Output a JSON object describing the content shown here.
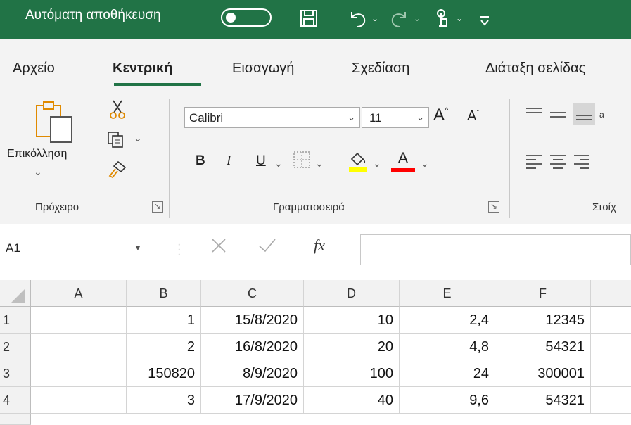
{
  "titlebar": {
    "autosave_label": "Αυτόματη αποθήκευση",
    "toggle_state": "off",
    "accent_color": "#217346",
    "qat_icons": [
      "save-icon",
      "undo-icon",
      "redo-icon",
      "touch-mode-icon",
      "customize-qat-icon"
    ]
  },
  "tabs": [
    {
      "label": "Αρχείο"
    },
    {
      "label": "Κεντρική",
      "active": true
    },
    {
      "label": "Εισαγωγή"
    },
    {
      "label": "Σχεδίαση"
    },
    {
      "label": "Διάταξη σελίδας"
    }
  ],
  "clipboard": {
    "paste_label": "Επικόλληση",
    "group_label": "Πρόχειρο"
  },
  "font": {
    "name": "Calibri",
    "size": "11",
    "group_label": "Γραμματοσειρά",
    "bold": "B",
    "italic": "I",
    "underline": "U",
    "font_color_letter": "A",
    "grow": "A",
    "shrink": "A",
    "highlight_color": "#ffff00",
    "font_color": "#ff0000"
  },
  "alignment": {
    "group_label": "Στοίχ"
  },
  "formula_bar": {
    "namebox": "A1",
    "fx": "fx",
    "formula": ""
  },
  "sheet": {
    "columns": [
      "A",
      "B",
      "C",
      "D",
      "E",
      "F"
    ],
    "rows": [
      {
        "num": "1",
        "cells": [
          "",
          "1",
          "15/8/2020",
          "10",
          "2,4",
          "12345"
        ]
      },
      {
        "num": "2",
        "cells": [
          "",
          "2",
          "16/8/2020",
          "20",
          "4,8",
          "54321"
        ]
      },
      {
        "num": "3",
        "cells": [
          "",
          "150820",
          "8/9/2020",
          "100",
          "24",
          "300001"
        ]
      },
      {
        "num": "4",
        "cells": [
          "",
          "3",
          "17/9/2020",
          "40",
          "9,6",
          "54321"
        ]
      }
    ]
  }
}
